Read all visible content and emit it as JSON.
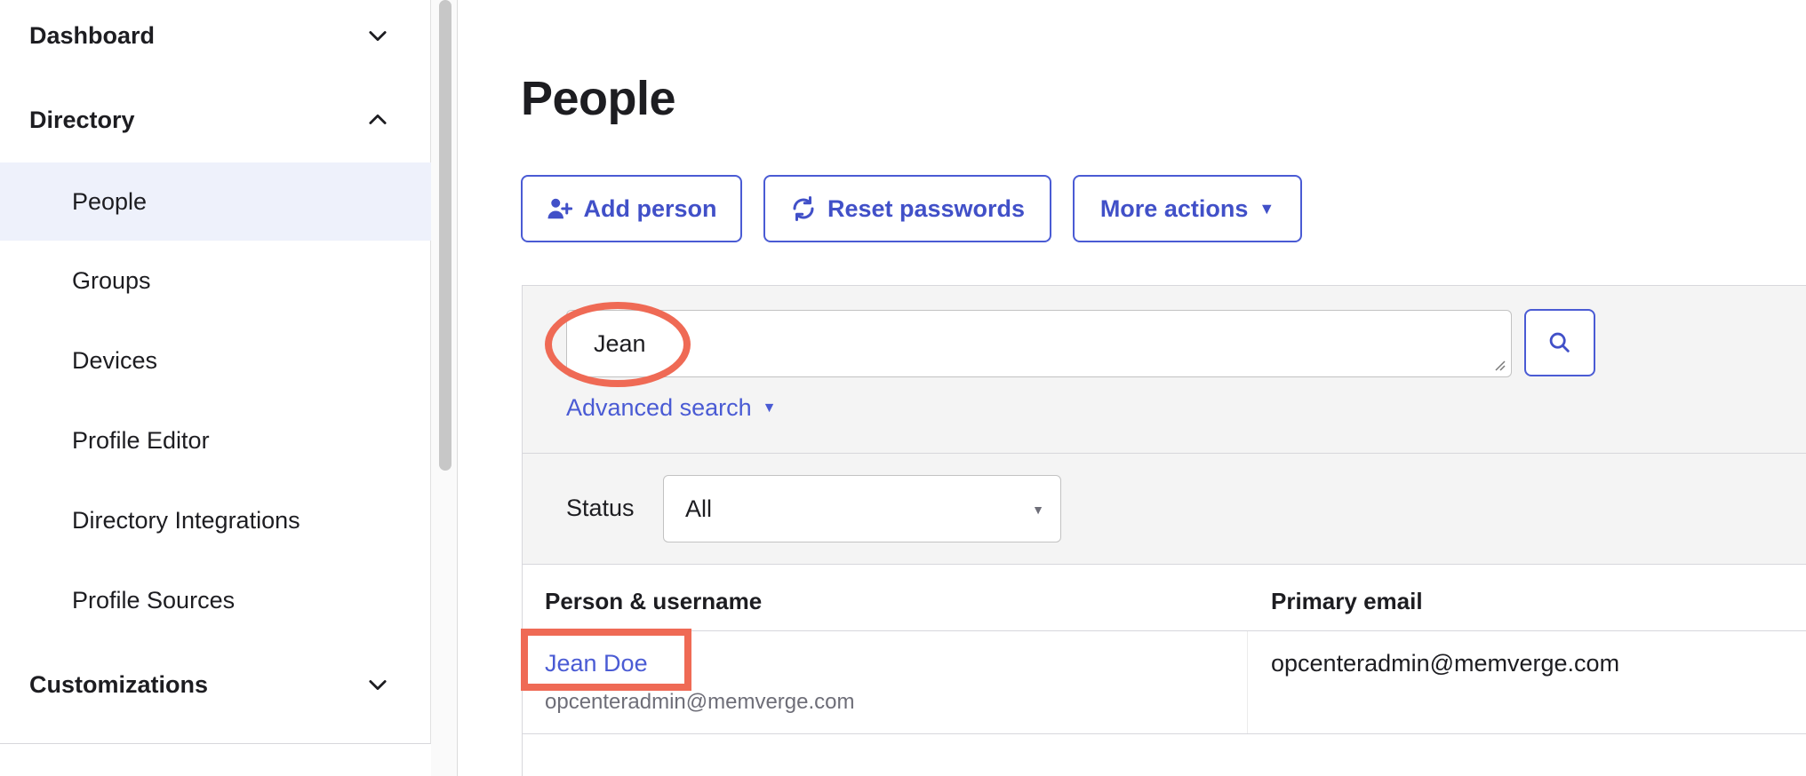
{
  "sidebar": {
    "sections": [
      {
        "label": "Dashboard",
        "expanded": false
      },
      {
        "label": "Directory",
        "expanded": true
      },
      {
        "label": "Customizations",
        "expanded": false
      }
    ],
    "directory_items": [
      {
        "label": "People",
        "active": true
      },
      {
        "label": "Groups"
      },
      {
        "label": "Devices"
      },
      {
        "label": "Profile Editor"
      },
      {
        "label": "Directory Integrations"
      },
      {
        "label": "Profile Sources"
      }
    ]
  },
  "main": {
    "title": "People",
    "actions": {
      "add_person": "Add person",
      "reset_passwords": "Reset passwords",
      "more_actions": "More actions"
    },
    "search": {
      "value": "Jean",
      "advanced_label": "Advanced search"
    },
    "filter": {
      "status_label": "Status",
      "status_value": "All"
    },
    "table": {
      "columns": [
        "Person & username",
        "Primary email"
      ],
      "rows": [
        {
          "name": "Jean Doe",
          "username": "opcenteradmin@memverge.com",
          "email": "opcenteradmin@memverge.com"
        }
      ]
    }
  },
  "colors": {
    "accent": "#4a5bd4",
    "annotation": "#ef6a55",
    "active_bg": "#eef1fb"
  }
}
